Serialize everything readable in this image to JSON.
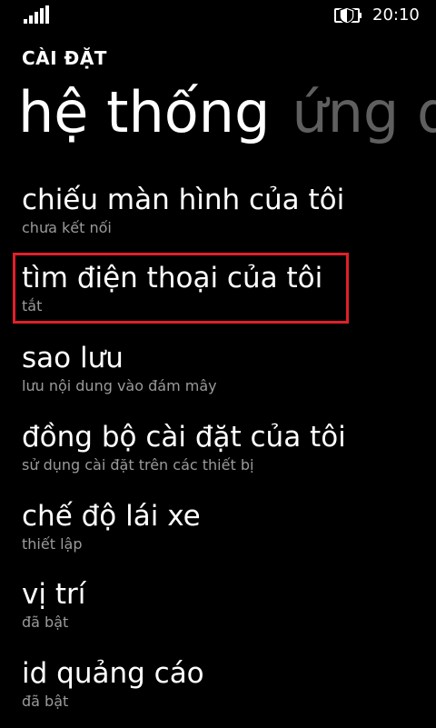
{
  "status_bar": {
    "signal_icon": "signal-strength-icon",
    "shield_icon": "shield-battery-icon",
    "time": "20:10"
  },
  "header": {
    "app_title": "CÀI ĐẶT",
    "pivots": [
      "hệ thống",
      "ứng d"
    ]
  },
  "settings": {
    "items": [
      {
        "title": "chiếu màn hình của tôi",
        "subtitle": "chưa kết nối"
      },
      {
        "title": "tìm điện thoại của tôi",
        "subtitle": "tắt"
      },
      {
        "title": "sao lưu",
        "subtitle": "lưu nội dung vào đám mây"
      },
      {
        "title": "đồng bộ cài đặt của tôi",
        "subtitle": "sử dụng cài đặt trên các thiết bị"
      },
      {
        "title": "chế độ lái xe",
        "subtitle": "thiết lập"
      },
      {
        "title": "vị trí",
        "subtitle": "đã bật"
      },
      {
        "title": "id quảng cáo",
        "subtitle": "đã bật"
      }
    ]
  },
  "colors": {
    "background": "#000000",
    "text": "#ffffff",
    "subtext": "#9a9a9a",
    "inactive_pivot": "#5f5f5f",
    "highlight": "#e0202a"
  }
}
